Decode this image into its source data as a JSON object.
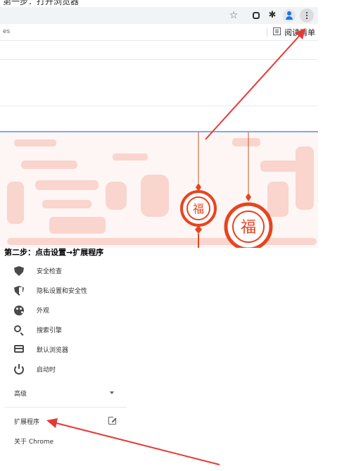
{
  "top_screenshot": {
    "cut_title": "第一步：打开浏览器",
    "toolbar": {
      "star_icon": "star-icon",
      "extension_icon": "extension-icon",
      "puzzle_icon": "puzzle-icon",
      "profile_icon": "profile-icon",
      "menu_icon": "three-dot-menu-icon"
    },
    "bookmarks_bar": {
      "left_text": "es",
      "reading_list_label": "阅读清单"
    },
    "festive_characters": [
      "福",
      "福"
    ],
    "accent_color": "#e8441f"
  },
  "step_caption": "第二步：点击设置→扩展程序",
  "settings_menu": {
    "items": [
      {
        "label": "安全检查",
        "icon": "shield-icon"
      },
      {
        "label": "隐私设置和安全性",
        "icon": "privacy-shield-icon"
      },
      {
        "label": "外观",
        "icon": "palette-icon"
      },
      {
        "label": "搜索引擎",
        "icon": "search-icon"
      },
      {
        "label": "默认浏览器",
        "icon": "browser-icon"
      },
      {
        "label": "启动时",
        "icon": "power-icon"
      }
    ],
    "advanced_label": "高级",
    "extensions_label": "扩展程序",
    "about_label": "关于 Chrome"
  },
  "annotation_color": "#e53935"
}
